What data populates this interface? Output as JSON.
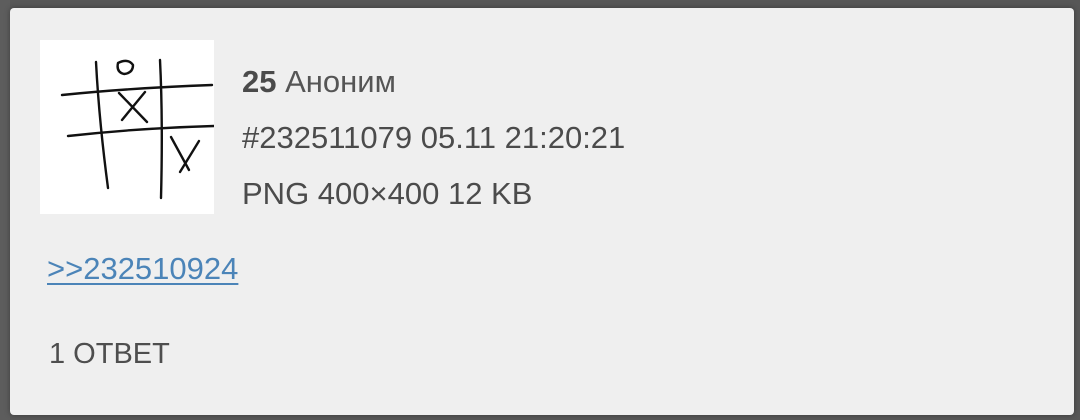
{
  "post": {
    "number": "25",
    "author": "Аноним",
    "id": "#232511079",
    "datetime": "05.11 21:20:21",
    "file_info": "PNG 400×400 12 KB",
    "reply_link": ">>232510924",
    "replies": "1 ОТВЕТ"
  },
  "thumbnail": {
    "icon": "tic-tac-toe-drawing",
    "background": "#ffffff",
    "ink": "#111111"
  },
  "colors": {
    "card": "#efefef",
    "backdrop": "#575757",
    "text": "#4b4b4b",
    "link": "#4b84b8"
  }
}
